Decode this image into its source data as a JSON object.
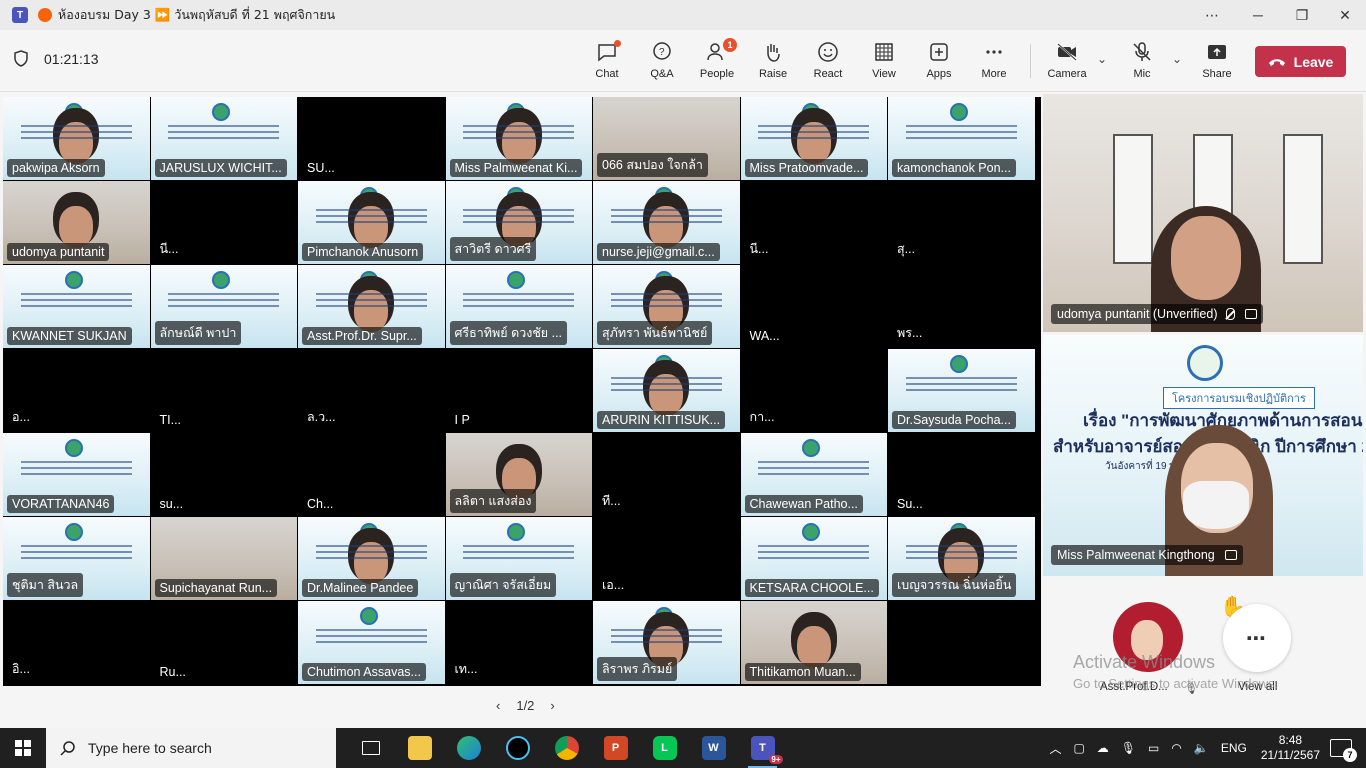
{
  "window": {
    "title": "ห้องอบรม Day 3 ⏩ วันพฤหัสบดี ที่ 21 พฤศจิกายน",
    "controls": {
      "more": "⋯",
      "minimize": "─",
      "restore": "❐",
      "close": "✕"
    }
  },
  "toolbar": {
    "timer": "01:21:13",
    "chat": "Chat",
    "qa": "Q&A",
    "people": "People",
    "people_badge": "1",
    "raise": "Raise",
    "react": "React",
    "view": "View",
    "apps": "Apps",
    "more": "More",
    "camera": "Camera",
    "mic": "Mic",
    "share": "Share",
    "leave": "Leave"
  },
  "participants": [
    "pakwipa Aksorn",
    "JARUSLUX WICHIT...",
    "SU...",
    "Miss Palmweenat Ki...",
    "066 สมปอง ใจกล้า",
    "Miss Pratoomvade...",
    "kamonchanok Pon...",
    "udomya puntanit",
    "นี...",
    "Pimchanok Anusorn",
    "สาวิตรี ดาวศรี",
    "nurse.jeji@gmail.c...",
    "นี...",
    "สุ...",
    "KWANNET SUKJAN",
    "ลักษณ์ดี พาปา",
    "Asst.Prof.Dr. Supr...",
    "ศรีธาทิพย์ ดวงชัย ...",
    "สุภัทรา พันธ์พานิชย์",
    "WA...",
    "พร...",
    "อ...",
    "TI...",
    "ล.ว...",
    "I P",
    "ARURIN KITTISUK...",
    "กา...",
    "Dr.Saysuda Pocha...",
    "VORATTANAN46",
    "su...",
    "Ch...",
    "ลลิตา แสงส่อง",
    "ที...",
    "Chawewan Patho...",
    "Su...",
    "ชุติมา สินวล",
    "Supichayanat Run...",
    "Dr.Malinee Pandee",
    "ญาณิศา จรัสเอี่ยม",
    "เอ...",
    "KETSARA CHOOLE...",
    "เบญจวรรณ ฉิ่นห่อยิ้น",
    "อิ...",
    "Ru...",
    "Chutimon Assavas...",
    "เท...",
    "ลิราพร ภิรมย์",
    "Thitikamon Muan..."
  ],
  "side": {
    "top_name": "udomya puntanit (Unverified)",
    "bottom_name": "Miss Palmweenat Kingthong",
    "slide_tag": "โครงการอบรมเชิงปฏิบัติการ",
    "slide_line1": "เรื่อง \"การพัฒนาศักยภาพด้านการสอน",
    "slide_line2": "สำหรับอาจารย์สอนภาคคลินิก ปีการศึกษา 2567 \"",
    "slide_date": "วันอังคารที่ 19 พฤศจิกายน 2567",
    "avatar_name": "Asst.Prof.D...",
    "view_all": "View all",
    "view_all_glyph": "⋯"
  },
  "pager": {
    "label": "1/2",
    "prev": "‹",
    "next": "›"
  },
  "watermark": {
    "line1": "Activate Windows",
    "line2": "Go to Settings to activate Windows."
  },
  "taskbar": {
    "search_placeholder": "Type here to search",
    "lang": "ENG",
    "time": "8:48",
    "date": "21/11/2567",
    "notif_count": "7",
    "teams_badge": "9+"
  }
}
